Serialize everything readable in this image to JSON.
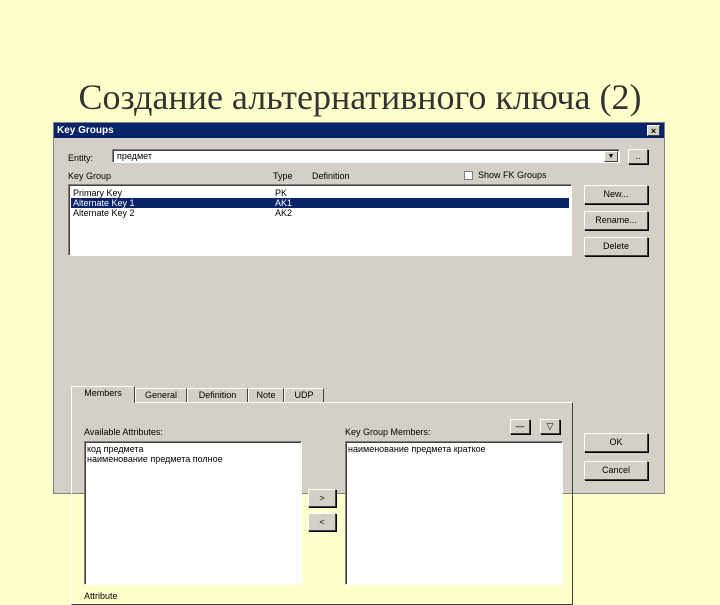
{
  "slide": {
    "title": "Создание альтернативного ключа (2)"
  },
  "window": {
    "title": "Key Groups",
    "close_glyph": "×"
  },
  "entity": {
    "label": "Entity:",
    "value": "предмет",
    "browse": ".."
  },
  "key_group_list": {
    "headers": {
      "key_group": "Key Group",
      "type": "Type",
      "definition": "Definition"
    },
    "show_fk": "Show FK Groups",
    "rows": [
      {
        "name": "Primary Key",
        "type": "PK",
        "selected": false
      },
      {
        "name": "Alternate Key 1",
        "type": "AK1",
        "selected": true
      },
      {
        "name": "Alternate Key 2",
        "type": "AK2",
        "selected": false
      }
    ]
  },
  "buttons": {
    "new": "New...",
    "rename": "Rename...",
    "delete": "Delete",
    "ok": "OK",
    "cancel": "Cancel",
    "move_right": ">",
    "move_left": "<",
    "move_up": "—",
    "move_down": "▽"
  },
  "tabs": [
    "Members",
    "General",
    "Definition",
    "Note",
    "UDP"
  ],
  "members": {
    "available_label": "Available Attributes:",
    "available": [
      "код предмета",
      "наименование предмета полное"
    ],
    "group_label": "Key Group Members:",
    "group": [
      "наименование предмета краткое"
    ],
    "attribute_label": "Attribute"
  },
  "colors": {
    "background": "#ffffcc",
    "dialog": "#d4d0c8",
    "titlebar": "#0a246a",
    "selection": "#0a246a"
  }
}
